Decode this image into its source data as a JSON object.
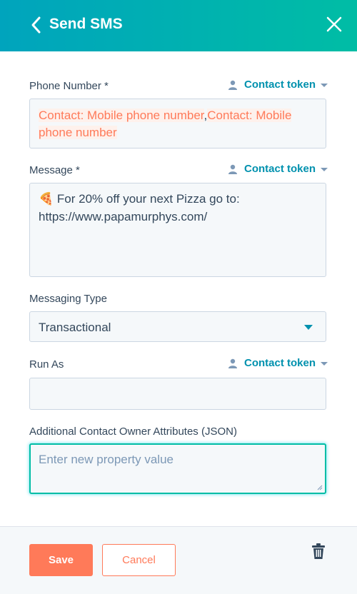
{
  "header": {
    "title": "Send SMS",
    "back_icon": "chevron-left-icon",
    "close_icon": "close-icon"
  },
  "phone_number": {
    "label": "Phone Number *",
    "token_label": "Contact token",
    "tokens": [
      "Contact: Mobile phone number",
      "Contact: Mobile phone number"
    ],
    "separator": ","
  },
  "message": {
    "label": "Message *",
    "token_label": "Contact token",
    "emoji": "🍕",
    "text": "For 20% off your next Pizza go to: https://www.papamurphys.com/"
  },
  "messaging_type": {
    "label": "Messaging Type",
    "value": "Transactional"
  },
  "run_as": {
    "label": "Run As",
    "token_label": "Contact token",
    "value": ""
  },
  "additional_attributes": {
    "label": "Additional Contact Owner Attributes (JSON)",
    "placeholder": "Enter new property value"
  },
  "footer": {
    "save_label": "Save",
    "cancel_label": "Cancel",
    "delete_icon": "trash-icon"
  },
  "colors": {
    "header_start": "#00a4bd",
    "header_end": "#00bda5",
    "accent": "#0091ae",
    "primary_button": "#ff7a59"
  }
}
